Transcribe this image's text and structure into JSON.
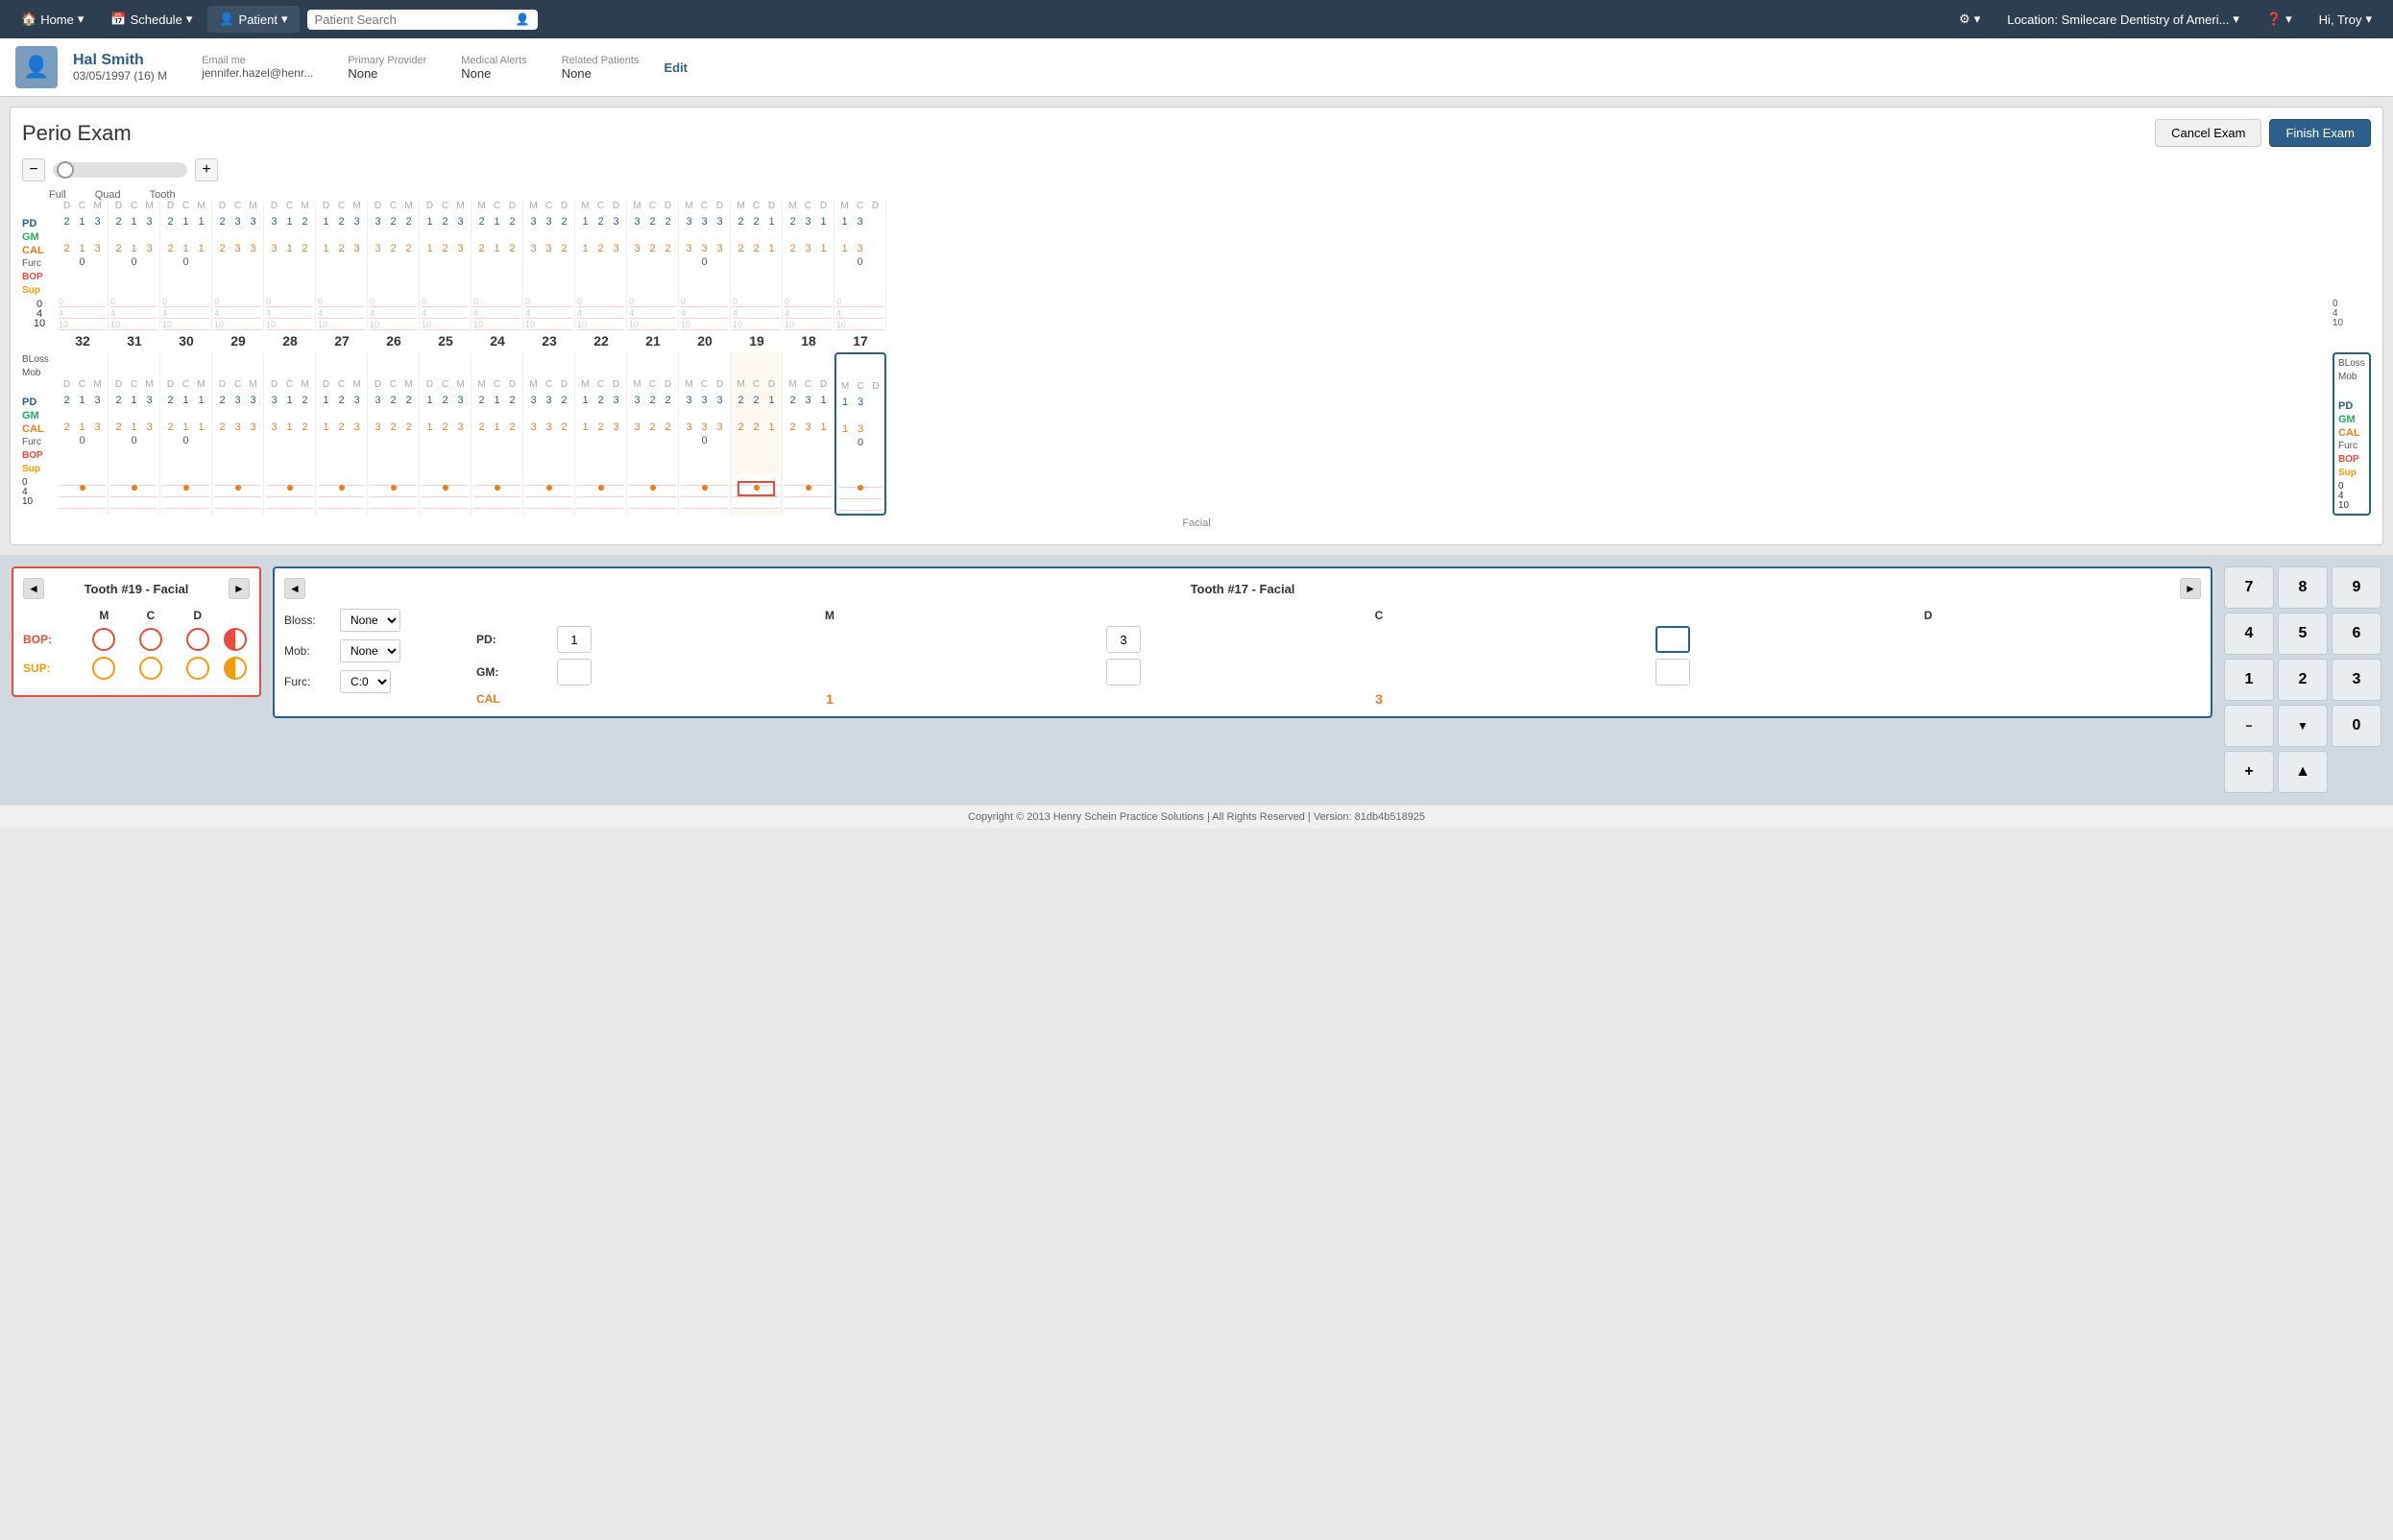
{
  "nav": {
    "home": "Home",
    "schedule": "Schedule",
    "patient": "Patient",
    "search_placeholder": "Patient Search",
    "location": "Location: Smilecare Dentistry of Ameri...",
    "greeting": "Hi, Troy"
  },
  "patient": {
    "name": "Hal Smith",
    "dob": "03/05/1997 (16) M",
    "email": "jennifer.hazel@henr...",
    "email_label": "Email me",
    "primary_provider_label": "Primary Provider",
    "primary_provider": "None",
    "medical_alerts_label": "Medical Alerts",
    "medical_alerts": "None",
    "related_patients_label": "Related Patients",
    "related_patients": "None",
    "edit": "Edit"
  },
  "exam": {
    "title": "Perio Exam",
    "cancel_btn": "Cancel Exam",
    "finish_btn": "Finish Exam"
  },
  "slider": {
    "minus": "−",
    "plus": "+",
    "labels": [
      "Full",
      "Quad",
      "Tooth"
    ]
  },
  "chart": {
    "upper_teeth": [
      {
        "num": "32",
        "dcm": [
          "D",
          "C",
          "M"
        ],
        "pd": [
          "2",
          "1",
          "3"
        ],
        "gm": [
          "",
          "",
          ""
        ],
        "cal": [
          "2",
          "1",
          "3"
        ],
        "furc": "0",
        "bop": "",
        "sup": ""
      },
      {
        "num": "31",
        "dcm": [
          "D",
          "C",
          "M"
        ],
        "pd": [
          "2",
          "1",
          "3"
        ],
        "gm": [
          "",
          "",
          ""
        ],
        "cal": [
          "2",
          "1",
          "3"
        ],
        "furc": "0",
        "bop": "",
        "sup": ""
      },
      {
        "num": "30",
        "dcm": [
          "D",
          "C",
          "M"
        ],
        "pd": [
          "2",
          "1",
          "1"
        ],
        "gm": [
          "",
          "",
          ""
        ],
        "cal": [
          "2",
          "1",
          "1"
        ],
        "furc": "0",
        "bop": "",
        "sup": ""
      },
      {
        "num": "29",
        "dcm": [
          "D",
          "C",
          "M"
        ],
        "pd": [
          "2",
          "3",
          "3"
        ],
        "gm": [
          "",
          "",
          ""
        ],
        "cal": [
          "2",
          "3",
          "3"
        ],
        "furc": "",
        "bop": "",
        "sup": ""
      },
      {
        "num": "28",
        "dcm": [
          "D",
          "C",
          "M"
        ],
        "pd": [
          "3",
          "1",
          "2"
        ],
        "gm": [
          "",
          "",
          ""
        ],
        "cal": [
          "3",
          "1",
          "2"
        ],
        "furc": "",
        "bop": "",
        "sup": ""
      },
      {
        "num": "27",
        "dcm": [
          "D",
          "C",
          "M"
        ],
        "pd": [
          "1",
          "2",
          "3"
        ],
        "gm": [
          "",
          "",
          ""
        ],
        "cal": [
          "1",
          "2",
          "3"
        ],
        "furc": "",
        "bop": "",
        "sup": ""
      },
      {
        "num": "26",
        "dcm": [
          "D",
          "C",
          "M"
        ],
        "pd": [
          "3",
          "2",
          "2"
        ],
        "gm": [
          "",
          "",
          ""
        ],
        "cal": [
          "3",
          "2",
          "2"
        ],
        "furc": "",
        "bop": "",
        "sup": ""
      },
      {
        "num": "25",
        "dcm": [
          "D",
          "C",
          "M"
        ],
        "pd": [
          "1",
          "2",
          "3"
        ],
        "gm": [
          "",
          "",
          ""
        ],
        "cal": [
          "1",
          "2",
          "3"
        ],
        "furc": "",
        "bop": "",
        "sup": ""
      },
      {
        "num": "24",
        "dcm": [
          "M",
          "C",
          "D"
        ],
        "pd": [
          "2",
          "1",
          "2"
        ],
        "gm": [
          "",
          "",
          ""
        ],
        "cal": [
          "2",
          "1",
          "2"
        ],
        "furc": "",
        "bop": "",
        "sup": ""
      },
      {
        "num": "23",
        "dcm": [
          "M",
          "C",
          "D"
        ],
        "pd": [
          "3",
          "3",
          "2"
        ],
        "gm": [
          "",
          "",
          ""
        ],
        "cal": [
          "3",
          "3",
          "2"
        ],
        "furc": "",
        "bop": "",
        "sup": ""
      },
      {
        "num": "22",
        "dcm": [
          "M",
          "C",
          "D"
        ],
        "pd": [
          "1",
          "2",
          "3"
        ],
        "gm": [
          "",
          "",
          ""
        ],
        "cal": [
          "1",
          "2",
          "3"
        ],
        "furc": "",
        "bop": "",
        "sup": ""
      },
      {
        "num": "21",
        "dcm": [
          "M",
          "C",
          "D"
        ],
        "pd": [
          "3",
          "2",
          "2"
        ],
        "gm": [
          "",
          "",
          ""
        ],
        "cal": [
          "3",
          "2",
          "2"
        ],
        "furc": "",
        "bop": "",
        "sup": ""
      },
      {
        "num": "20",
        "dcm": [
          "M",
          "C",
          "D"
        ],
        "pd": [
          "3",
          "3",
          "3"
        ],
        "gm": [
          "",
          "",
          ""
        ],
        "cal": [
          "3",
          "3",
          "3"
        ],
        "furc": "0",
        "bop": "",
        "sup": ""
      },
      {
        "num": "19",
        "dcm": [
          "M",
          "C",
          "D"
        ],
        "pd": [
          "2",
          "2",
          "1"
        ],
        "gm": [
          "",
          "",
          ""
        ],
        "cal": [
          "2",
          "2",
          "1"
        ],
        "furc": "",
        "bop": "",
        "sup": ""
      },
      {
        "num": "18",
        "dcm": [
          "M",
          "C",
          "D"
        ],
        "pd": [
          "2",
          "3",
          "1"
        ],
        "gm": [
          "",
          "",
          ""
        ],
        "cal": [
          "2",
          "3",
          "1"
        ],
        "furc": "",
        "bop": "",
        "sup": ""
      },
      {
        "num": "17",
        "dcm": [
          "M",
          "C",
          "D"
        ],
        "pd": [
          "1",
          "3",
          ""
        ],
        "gm": [
          "",
          "",
          ""
        ],
        "cal": [
          "1",
          "3",
          ""
        ],
        "furc": "0",
        "bop": "",
        "sup": ""
      }
    ],
    "row_labels": {
      "pd": "PD",
      "gm": "GM",
      "cal": "CAL",
      "furc": "Furc",
      "bop": "BOP",
      "sup": "Sup",
      "bloss": "BLoss",
      "mob": "Mob"
    },
    "graph_labels": [
      "0",
      "4",
      "10"
    ],
    "facial_label": "Facial"
  },
  "tooth19_panel": {
    "title": "Tooth #19 - Facial",
    "col_headers": [
      "",
      "M",
      "C",
      "D",
      ""
    ],
    "bop_label": "BOP:",
    "sup_label": "SUP:",
    "nav_left": "◄",
    "nav_right": "►"
  },
  "tooth17_panel": {
    "title": "Tooth #17 - Facial",
    "bloss_label": "Bloss:",
    "bloss_value": "None",
    "mob_label": "Mob:",
    "mob_value": "None",
    "furc_label": "Furc:",
    "furc_value": "C:0",
    "col_headers": [
      "",
      "M",
      "C",
      "D"
    ],
    "pd_label": "PD:",
    "pd_m": "1",
    "pd_c": "3",
    "pd_d": "",
    "gm_label": "GM:",
    "cal_label": "CAL",
    "cal_m": "1",
    "cal_c": "3",
    "nav_left": "◄",
    "nav_right": "►"
  },
  "numpad": {
    "keys": [
      "7",
      "8",
      "9",
      "4",
      "5",
      "6",
      "1",
      "2",
      "3"
    ],
    "minus_btn": "−",
    "down_btn": "▼",
    "zero_btn": "0",
    "plus_btn": "+",
    "up_btn": "▲"
  },
  "footer": {
    "text": "Copyright © 2013 Henry Schein Practice Solutions | All Rights Reserved | Version: 81db4b518925"
  }
}
